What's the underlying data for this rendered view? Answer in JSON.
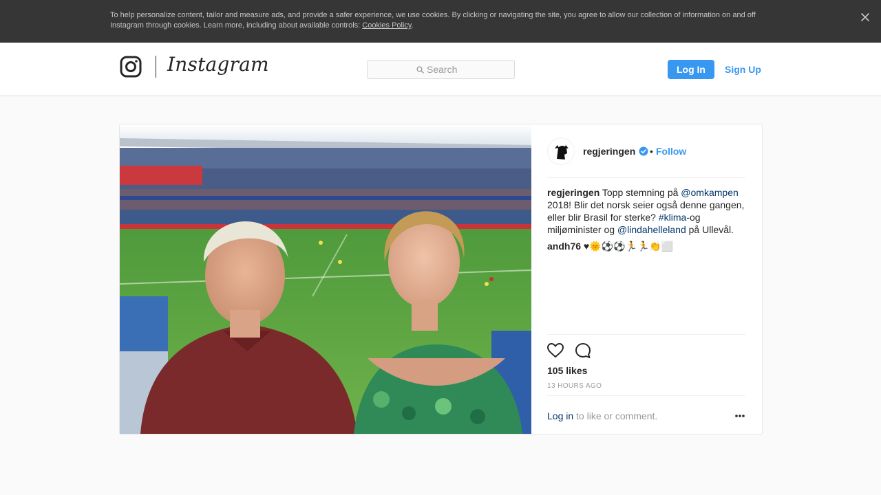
{
  "cookie_banner": {
    "text": "To help personalize content, tailor and measure ads, and provide a safer experience, we use cookies. By clicking or navigating the site, you agree to allow our collection of information on and off Instagram through cookies. Learn more, including about available controls: ",
    "link": "Cookies Policy",
    "link_suffix": ".",
    "close_icon": "close-icon"
  },
  "header": {
    "logo_icon": "instagram-camera-icon",
    "wordmark": "Instagram",
    "search_placeholder": "Search",
    "login_label": "Log In",
    "signup_label": "Sign Up"
  },
  "post": {
    "owner": "regjeringen",
    "verified_icon": "verified-badge-icon",
    "separator": "•",
    "follow_label": "Follow",
    "caption": {
      "user": "regjeringen",
      "t1": " Topp stemning på ",
      "mention1": "@omkampen",
      "t2": " 2018! Blir det norsk seier også denne gangen, eller blir Brasil for sterke? ",
      "hashtag": "#klima",
      "t3": "-og miljøminister og ",
      "mention2": "@lindahelleland",
      "t4": " på Ullevål."
    },
    "comment": {
      "user": "andh76",
      "text": " ♥🌞⚽⚽🏃🏃👏⬜"
    },
    "likes": "105 likes",
    "time": "13 HOURS AGO",
    "login_link": "Log in",
    "login_suffix": " to like or comment.",
    "colors": {
      "accent": "#3897f0",
      "link": "#003569",
      "banner": "#363636"
    }
  }
}
